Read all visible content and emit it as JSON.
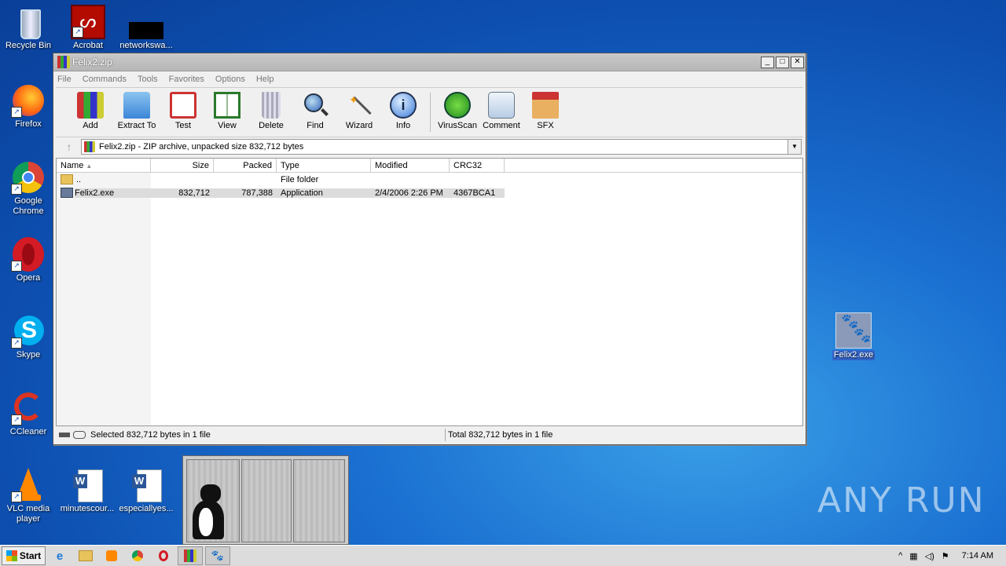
{
  "desktop": {
    "icons_left": [
      {
        "label": "Recycle Bin",
        "icon": "recycle-bin-icon"
      },
      {
        "label": "Firefox",
        "icon": "firefox-icon"
      },
      {
        "label": "Google Chrome",
        "icon": "chrome-icon"
      },
      {
        "label": "Opera",
        "icon": "opera-icon"
      },
      {
        "label": "Skype",
        "icon": "skype-icon"
      },
      {
        "label": "CCleaner",
        "icon": "ccleaner-icon"
      },
      {
        "label": "VLC media player",
        "icon": "vlc-icon"
      }
    ],
    "icons_top": [
      {
        "label": "Acrobat",
        "icon": "acrobat-icon"
      },
      {
        "label": "networkswa...",
        "icon": "black-file-icon"
      }
    ],
    "icons_bottom": [
      {
        "label": "minutescour...",
        "icon": "word-doc-icon"
      },
      {
        "label": "especiallyes...",
        "icon": "word-doc-icon"
      }
    ],
    "selected_icon": {
      "label": "Felix2.exe",
      "icon": "felix-paw-icon"
    },
    "watermark": "ANY RUN"
  },
  "window": {
    "title": "Felix2.zip",
    "menu": [
      "File",
      "Commands",
      "Tools",
      "Favorites",
      "Options",
      "Help"
    ],
    "toolbar": [
      {
        "label": "Add",
        "icon": "add-archive-icon"
      },
      {
        "label": "Extract To",
        "icon": "extract-folder-icon"
      },
      {
        "label": "Test",
        "icon": "test-clipboard-icon"
      },
      {
        "label": "View",
        "icon": "view-book-icon"
      },
      {
        "label": "Delete",
        "icon": "delete-trash-icon"
      },
      {
        "label": "Find",
        "icon": "find-magnifier-icon"
      },
      {
        "label": "Wizard",
        "icon": "wizard-wand-icon"
      },
      {
        "label": "Info",
        "icon": "info-icon"
      },
      {
        "label": "VirusScan",
        "icon": "virusscan-icon"
      },
      {
        "label": "Comment",
        "icon": "comment-icon"
      },
      {
        "label": "SFX",
        "icon": "sfx-icon"
      }
    ],
    "address": "Felix2.zip - ZIP archive, unpacked size 832,712 bytes",
    "columns": [
      "Name",
      "Size",
      "Packed",
      "Type",
      "Modified",
      "CRC32"
    ],
    "rows": [
      {
        "name": "..",
        "size": "",
        "packed": "",
        "type": "File folder",
        "modified": "",
        "crc": ""
      },
      {
        "name": "Felix2.exe",
        "size": "832,712",
        "packed": "787,388",
        "type": "Application",
        "modified": "2/4/2006 2:26 PM",
        "crc": "4367BCA1"
      }
    ],
    "status_left": "Selected 832,712 bytes in 1 file",
    "status_right": "Total 832,712 bytes in 1 file"
  },
  "taskbar": {
    "start_label": "Start",
    "clock": "7:14 AM"
  }
}
